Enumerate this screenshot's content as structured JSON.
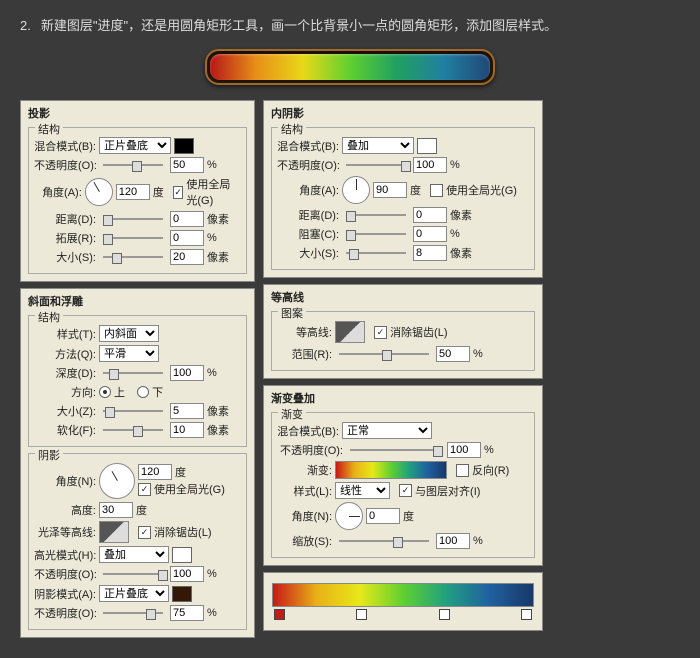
{
  "instr": {
    "n": "2.",
    "txt": "新建图层\"进度\"，还是用圆角矩形工具，画一个比背景小一点的圆角矩形，添加图层样式。"
  },
  "common": {
    "jiegou": "结构",
    "yinying": "阴影",
    "tuan": "图案",
    "jianbian": "渐变",
    "opac": "不透明度(O):",
    "angle": "角度(A):",
    "angleN": "角度(N):",
    "dist": "距离(D):",
    "du": "度",
    "px": "像素",
    "pct": "%",
    "global": "使用全局光(G)",
    "anti": "消除锯齿(L)",
    "blend": "混合模式(B):",
    "size": "大小(S):",
    "sizeZ": "大小(Z):"
  },
  "ds": {
    "title": "投影",
    "mode": "正片叠底",
    "opac": "50",
    "angle": "120",
    "gl": true,
    "dist": "0",
    "spread": "拓展(R):",
    "spreadV": "0",
    "size": "20",
    "sw": "#000000"
  },
  "is": {
    "title": "内阴影",
    "mode": "叠加",
    "opac": "100",
    "angle": "90",
    "gl": false,
    "dist": "0",
    "choke": "阻塞(C):",
    "chokeV": "0",
    "size": "8",
    "sw": "#ffffff"
  },
  "bv": {
    "title": "斜面和浮雕",
    "style": "样式(T):",
    "styleV": "内斜面",
    "tech": "方法(Q):",
    "techV": "平滑",
    "depth": "深度(D):",
    "depthV": "100",
    "dir": "方向:",
    "up": "上",
    "down": "下",
    "sizeV": "5",
    "soft": "软化(F):",
    "softV": "10",
    "angV": "120",
    "gl": true,
    "alt": "高度:",
    "altV": "30",
    "gloss": "光泽等高线:",
    "hl": "高光模式(H):",
    "hlV": "叠加",
    "hlO": "100",
    "sh": "阴影模式(A):",
    "shV": "正片叠底",
    "shO": "75",
    "hlSw": "#ffffff",
    "shSw": "#331808"
  },
  "ct": {
    "title": "等高线",
    "lbl": "等高线:",
    "anti": true,
    "range": "范围(R):",
    "rangeV": "50"
  },
  "go": {
    "title": "渐变叠加",
    "mode": "正常",
    "opac": "100",
    "grad": "渐变:",
    "rev": "反向(R)",
    "style": "样式(L):",
    "styleV": "线性",
    "align": "与图层对齐(I)",
    "angV": "0",
    "scale": "缩放(S):",
    "scaleV": "100"
  }
}
